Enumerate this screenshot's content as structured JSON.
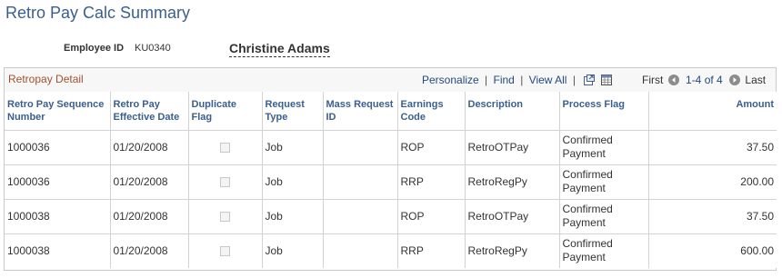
{
  "page": {
    "title": "Retro Pay Calc Summary"
  },
  "employee": {
    "id_label": "Employee ID",
    "id_value": "KU0340",
    "name": "Christine Adams"
  },
  "grid": {
    "title": "Retropay Detail",
    "nav": {
      "personalize": "Personalize",
      "find": "Find",
      "view_all": "View All",
      "sep": "|"
    },
    "pager": {
      "first": "First",
      "range": "1-4 of 4",
      "last": "Last"
    },
    "columns": [
      "Retro Pay Sequence Number",
      "Retro Pay Effective Date",
      "Duplicate Flag",
      "Request Type",
      "Mass Request ID",
      "Earnings Code",
      "Description",
      "Process Flag",
      "Amount"
    ],
    "rows": [
      {
        "seq": "1000036",
        "eff_date": "01/20/2008",
        "dup": false,
        "req_type": "Job",
        "mass_id": "",
        "earn_code": "ROP",
        "desc": "RetroOTPay",
        "flag": "Confirmed Payment",
        "amount": "37.50"
      },
      {
        "seq": "1000036",
        "eff_date": "01/20/2008",
        "dup": false,
        "req_type": "Job",
        "mass_id": "",
        "earn_code": "RRP",
        "desc": "RetroRegPy",
        "flag": "Confirmed Payment",
        "amount": "200.00"
      },
      {
        "seq": "1000038",
        "eff_date": "01/20/2008",
        "dup": false,
        "req_type": "Job",
        "mass_id": "",
        "earn_code": "ROP",
        "desc": "RetroOTPay",
        "flag": "Confirmed Payment",
        "amount": "37.50"
      },
      {
        "seq": "1000038",
        "eff_date": "01/20/2008",
        "dup": false,
        "req_type": "Job",
        "mass_id": "",
        "earn_code": "RRP",
        "desc": "RetroRegPy",
        "flag": "Confirmed Payment",
        "amount": "600.00"
      }
    ]
  },
  "icons": {
    "zoom": "new-window-icon",
    "download": "spreadsheet-download-icon",
    "prev": "previous-arrow-icon",
    "next": "next-arrow-icon"
  },
  "colors": {
    "title": "#3a5f8e",
    "grid_title": "#a0522d",
    "link": "#234a7d",
    "header_text": "#3a5f8e"
  }
}
